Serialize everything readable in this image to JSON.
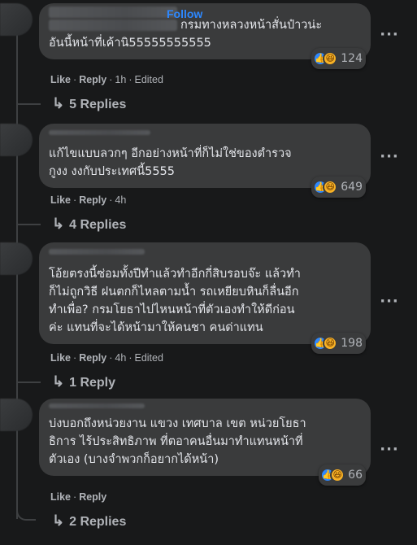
{
  "comments": [
    {
      "follow_label": "Follow",
      "text_line1": "กรมทางหลวงหน้าสั่นป๋าวน่ะ",
      "text_line2": "อันนี้หน้าที่เค้านิ55555555555",
      "reaction_count": "124",
      "actions": {
        "like": "Like",
        "reply": "Reply",
        "time": "1h",
        "edited": "Edited"
      },
      "replies_label": "5 Replies"
    },
    {
      "text_line1": "แก้ไขแบบลวกๆ อีกอย่างหน้าที่ก็ไม่ใช่ของตำรวจ",
      "text_line2": "กูงง งงกับประเทศนี้5555",
      "reaction_count": "649",
      "actions": {
        "like": "Like",
        "reply": "Reply",
        "time": "4h"
      },
      "replies_label": "4 Replies"
    },
    {
      "text_line1": "โอ้ยตรงนี้ซ่อมทั้งปีทำแล้วทำอีกกี่สิบรอบจ๊ะ แล้วทำ",
      "text_line2": "ก็ไม่ถูกวิธี ฝนตกก็ไหลตามน้ำ รถเหยียบหินก็ลื่นอีก",
      "text_line3": "ทำเพื่อ? กรมโยธาไปไหนหน้าที่ตัวเองทำให้ดีก่อน",
      "text_line4": "ค่ะ แทนที่จะได้หน้ามาให้คนชา คนด่าแทน",
      "reaction_count": "198",
      "actions": {
        "like": "Like",
        "reply": "Reply",
        "time": "4h",
        "edited": "Edited"
      },
      "replies_label": "1 Reply"
    },
    {
      "text_line1": "บ่งบอกถึงหน่วยงาน แขวง เทศบาล เขต หน่วยโยธา",
      "text_line2": "ธิการ ไร้ประสิทธิภาพ ที่ตอาคนอื่นมาทำแทนหน้าที่",
      "text_line3": "ตัวเอง (บางจำพวกก็อยากได้หน้า)",
      "reaction_count": "66",
      "actions": {
        "like": "Like",
        "reply": "Reply"
      },
      "replies_label": "2 Replies"
    }
  ],
  "icons": {
    "like": "like-reaction-icon",
    "haha": "haha-reaction-icon",
    "more": "more-options-icon",
    "reply_arrow": "reply-arrow-icon"
  },
  "colors": {
    "background": "#18191a",
    "bubble": "#3a3b3c",
    "text": "#e4e6eb",
    "muted": "#b0b3b8",
    "accent": "#2d88ff"
  }
}
